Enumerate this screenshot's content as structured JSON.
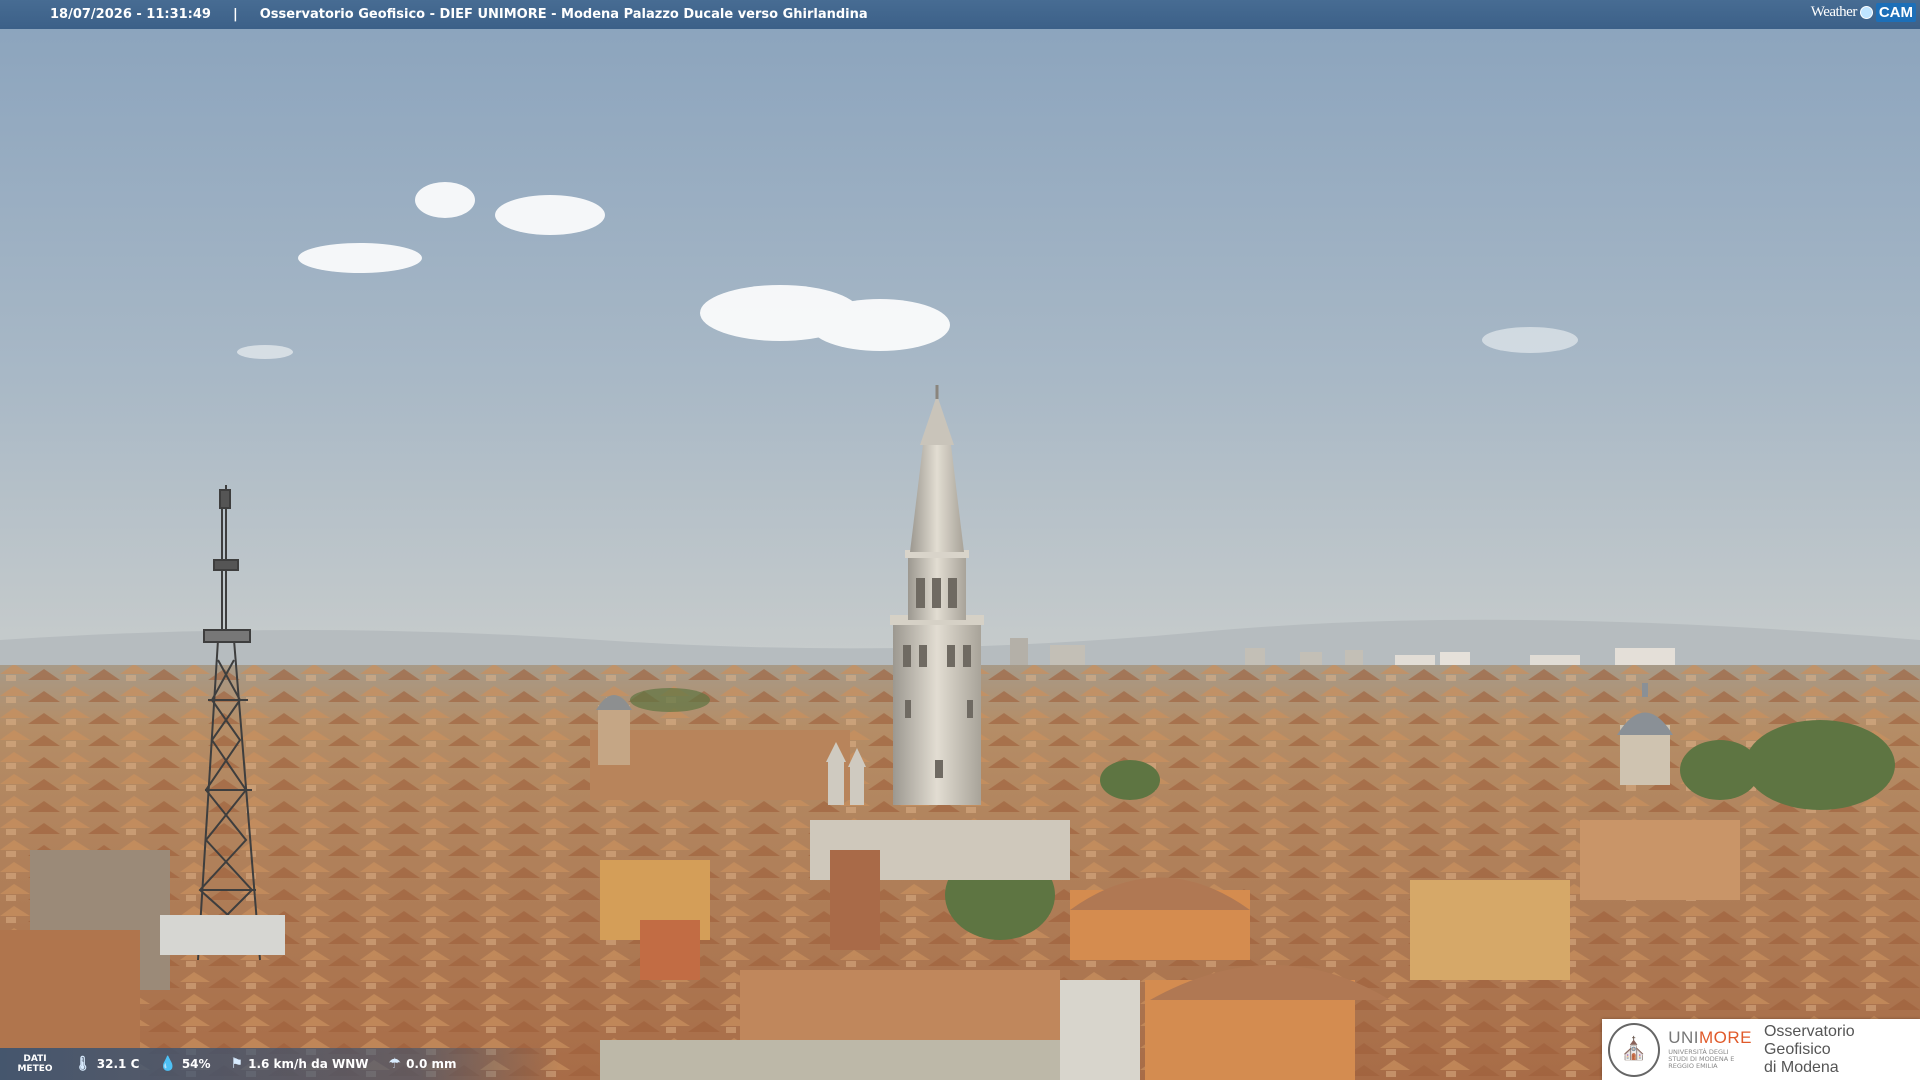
{
  "header": {
    "timestamp": "18/07/2026 - 11:31:49",
    "separator": "|",
    "title": "Osservatorio Geofisico - DIEF UNIMORE - Modena Palazzo Ducale verso Ghirlandina",
    "brand_weather": "Weather",
    "brand_cam": "CAM"
  },
  "meteo_bar": {
    "label_line1": "DATI",
    "label_line2": "METEO",
    "items": [
      {
        "icon": "thermometer-icon",
        "value": "32.1 C"
      },
      {
        "icon": "humidity-icon",
        "value": "54%"
      },
      {
        "icon": "wind-icon",
        "value": "1.6 km/h da WNW"
      },
      {
        "icon": "rain-icon",
        "value": "0.0 mm"
      }
    ]
  },
  "logo": {
    "uni_prefix": "UNI",
    "uni_suffix": "MORE",
    "uni_subtitle": "UNIVERSITÀ DEGLI STUDI DI MODENA E REGGIO EMILIA",
    "observatory_line1": "Osservatorio Geofisico",
    "observatory_line2": "di Modena"
  },
  "colors": {
    "sky_top": "#8ea7c0",
    "sky_horizon": "#c5cbcc",
    "roof": "#b9865a",
    "header_bar": "#436891"
  }
}
